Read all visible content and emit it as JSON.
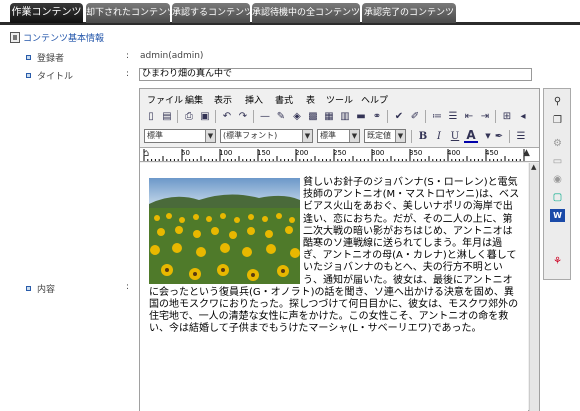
{
  "tabs": [
    {
      "label": "作業コンテンツ",
      "active": true
    },
    {
      "label": "却下されたコンテンツ",
      "active": false
    },
    {
      "label": "承認するコンテンツ",
      "active": false
    },
    {
      "label": "承認待機中の全コンテンツ",
      "active": false
    },
    {
      "label": "承認完了のコンテンツ",
      "active": false
    }
  ],
  "section_title": "コンテンツ基本情報",
  "fields": {
    "registrant_label": "登録者",
    "registrant_value": "admin(admin)",
    "title_label": "タイトル",
    "title_value": "ひまわり畑の真ん中で",
    "content_label": "内容",
    "colon": ":"
  },
  "editor": {
    "menu": [
      "ファイル",
      "編集",
      "表示",
      "挿入",
      "書式",
      "表",
      "ツール",
      "ヘルプ"
    ],
    "style_select": "標準",
    "font_select": "(標準フォント)",
    "size_select": "標準",
    "default_select": "既定値",
    "ruler_labels": [
      "50",
      "100",
      "150",
      "200",
      "250",
      "300",
      "350",
      "400",
      "450"
    ],
    "body_text": "貧しいお針子のジョバンナ(S・ローレン)と電気技師のアントニオ(M・マストロヤンニ)は、ベスビアス火山をあおぐ、美しいナポリの海岸で出逢い、恋におちた。だが、その二人の上に、第二次大戦の暗い影がおちはじめ、アントニオは酷寒のソ連戦線に送られてしまう。年月は過ぎ、アントニオの母(A・カレナ)と淋しく暮していたジョバンナのもとへ、夫の行方不明という、通知が届いた。彼女は、最後にアントニオに会ったという復員兵(G・オノラト)の話を聞き、ソ連へ出かける決意を固め、異国の地モスクワにおりたった。探しつづけて何日目かに、彼女は、モスクワ郊外の住宅地で、一人の清楚な女性に声をかけた。この女性こそ、アントニオの命を救い、今は結婚して子供までもうけたマーシャ(L・サベーリエワ)であった。"
  },
  "colors": {
    "tab_active": "#1a1a1a",
    "tab_inactive": "#5a5a5a",
    "link_blue": "#2255aa"
  }
}
